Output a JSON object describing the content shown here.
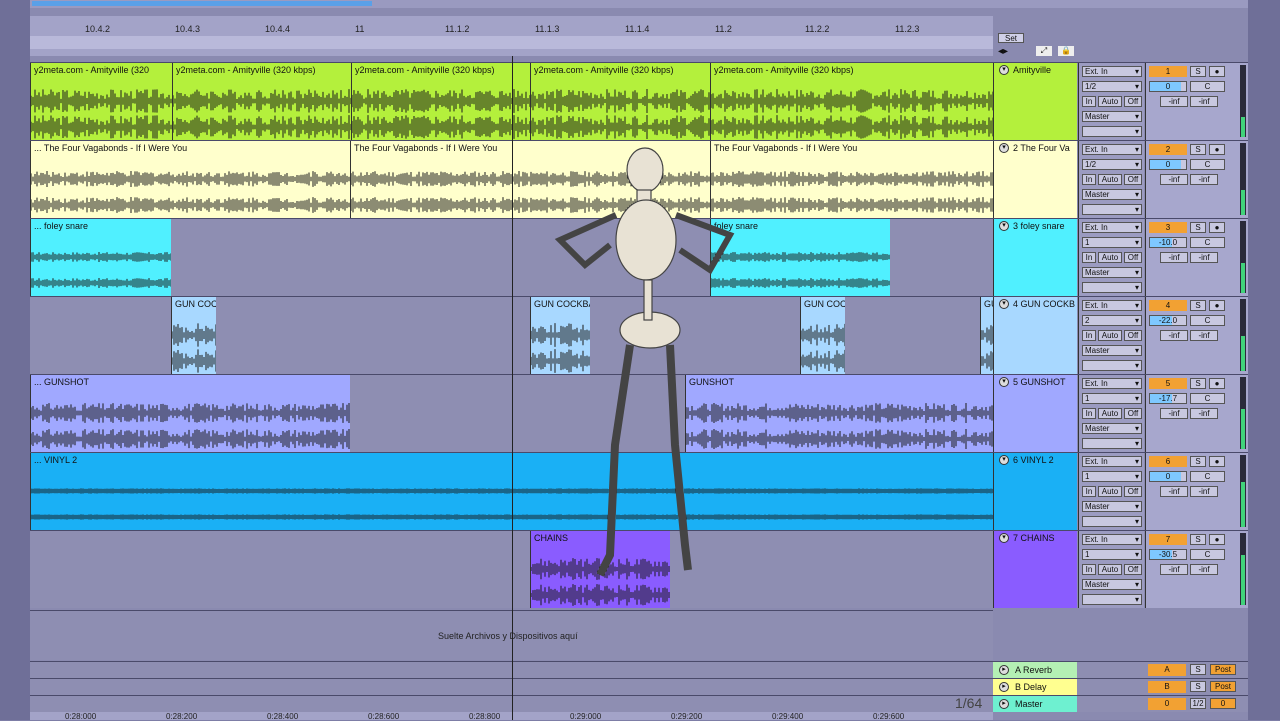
{
  "ruler": {
    "ticks": [
      "10.4.2",
      "10.4.3",
      "10.4.4",
      "11",
      "11.1.2",
      "11.1.3",
      "11.1.4",
      "11.2",
      "11.2.2",
      "11.2.3"
    ],
    "set_label": "Set"
  },
  "tracks": [
    {
      "name": "Amityville",
      "color": "#b4f03c",
      "clips": [
        "y2meta.com - Amityville (320",
        "y2meta.com - Amityville (320 kbps)",
        "y2meta.com - Amityville (320 kbps)",
        "y2meta.com - Amityville (320 kbps)",
        "y2meta.com - Amityville (320 kbps)"
      ],
      "input": "Ext. In",
      "channel": "1/2",
      "monitor": [
        "In",
        "Auto",
        "Off"
      ],
      "output": "Master",
      "number": "1",
      "volume": "0",
      "pan": "C",
      "send_a": "-inf",
      "send_b": "-inf"
    },
    {
      "name": "2 The Four Va",
      "color": "#ffffcc",
      "clips": [
        "... The Four Vagabonds - If I Were You",
        "The Four Vagabonds - If I Were You",
        "The Four Vagabonds - If I Were You"
      ],
      "input": "Ext. In",
      "channel": "1/2",
      "monitor": [
        "In",
        "Auto",
        "Off"
      ],
      "output": "Master",
      "number": "2",
      "volume": "0",
      "pan": "C",
      "send_a": "-inf",
      "send_b": "-inf"
    },
    {
      "name": "3 foley snare",
      "color": "#50f0ff",
      "clips": [
        "... foley snare",
        "foley snare"
      ],
      "input": "Ext. In",
      "channel": "1",
      "monitor": [
        "In",
        "Auto",
        "Off"
      ],
      "output": "Master",
      "number": "3",
      "volume": "-10.0",
      "pan": "C",
      "send_a": "-inf",
      "send_b": "-inf"
    },
    {
      "name": "4 GUN COCKB",
      "color": "#a8d8ff",
      "clips": [
        "GUN COCK",
        "GUN COCKBA",
        "GUN COCK",
        "GU"
      ],
      "input": "Ext. In",
      "channel": "2",
      "monitor": [
        "In",
        "Auto",
        "Off"
      ],
      "output": "Master",
      "number": "4",
      "volume": "-22.0",
      "pan": "C",
      "send_a": "-inf",
      "send_b": "-inf"
    },
    {
      "name": "5 GUNSHOT",
      "color": "#a0a8ff",
      "clips": [
        "... GUNSHOT",
        "GUNSHOT"
      ],
      "input": "Ext. In",
      "channel": "1",
      "monitor": [
        "In",
        "Auto",
        "Off"
      ],
      "output": "Master",
      "number": "5",
      "volume": "-17.7",
      "pan": "C",
      "send_a": "-inf",
      "send_b": "-inf"
    },
    {
      "name": "6 VINYL 2",
      "color": "#1ab0f5",
      "clips": [
        "... VINYL 2"
      ],
      "input": "Ext. In",
      "channel": "1",
      "monitor": [
        "In",
        "Auto",
        "Off"
      ],
      "output": "Master",
      "number": "6",
      "volume": "0",
      "pan": "C",
      "send_a": "-inf",
      "send_b": "-inf"
    },
    {
      "name": "7 CHAINS",
      "color": "#8a5cff",
      "clips": [
        "CHAINS"
      ],
      "input": "Ext. In",
      "channel": "1",
      "monitor": [
        "In",
        "Auto",
        "Off"
      ],
      "output": "Master",
      "number": "7",
      "volume": "-30.5",
      "pan": "C",
      "send_a": "-inf",
      "send_b": "-inf"
    }
  ],
  "drop_text": "Suelte Archivos y Dispositivos aquí",
  "returns": [
    {
      "name": "A Reverb",
      "letter": "A",
      "s": "S",
      "post": "Post",
      "color": "#b4f0b4"
    },
    {
      "name": "B Delay",
      "letter": "B",
      "s": "S",
      "post": "Post",
      "color": "#ffff90"
    },
    {
      "name": "Master",
      "letter": "0",
      "s": "1/2",
      "post": "0",
      "color": "#6ef0d0"
    }
  ],
  "zoom": "1/64",
  "time_ticks": [
    "0:28:000",
    "0:28:200",
    "0:28:400",
    "0:28:600",
    "0:28:800",
    "0:29:000",
    "0:29:200",
    "0:29:400",
    "0:29:600"
  ]
}
